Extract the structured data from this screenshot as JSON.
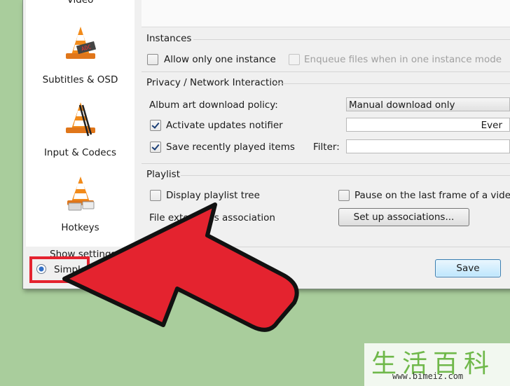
{
  "sidebar": {
    "items": [
      {
        "label": "Video"
      },
      {
        "label": "Subtitles & OSD"
      },
      {
        "label": "Input & Codecs"
      },
      {
        "label": "Hotkeys"
      }
    ]
  },
  "show_settings": {
    "label": "Show settings",
    "simple": "Simple"
  },
  "instances": {
    "title": "Instances",
    "allow_one": "Allow only one instance",
    "enqueue": "Enqueue files when in one instance mode"
  },
  "privacy": {
    "title": "Privacy / Network Interaction",
    "album_art_label": "Album art download policy:",
    "album_art_value": "Manual download only",
    "updates_label": "Activate updates notifier",
    "updates_value": "Ever",
    "recent_label": "Save recently played items",
    "filter_label": "Filter:"
  },
  "playlist": {
    "title": "Playlist",
    "tree": "Display playlist tree",
    "pause_last": "Pause on the last frame of a video",
    "ext_assoc": "File extensions association",
    "setup_button": "Set up associations..."
  },
  "footer": {
    "save": "Save"
  },
  "watermark": {
    "chars": "生活百科",
    "url": "www.bimeiz.com"
  },
  "colors": {
    "arrow": "#e4232f",
    "background": "#a9cd9c"
  }
}
